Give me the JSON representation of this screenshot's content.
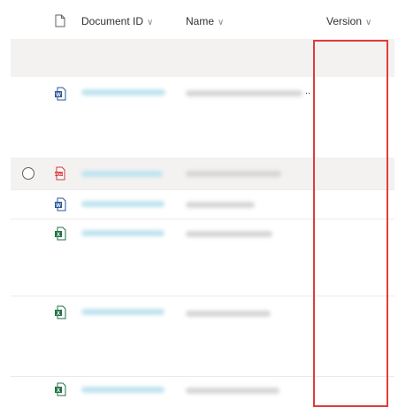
{
  "columns": {
    "document_id": "Document ID",
    "name": "Name",
    "version": "Version"
  },
  "icons": {
    "header_file": "file-icon",
    "sort_chevron": "chevron-down-icon",
    "word": "word-file-icon",
    "pdf": "pdf-file-icon",
    "excel": "excel-file-icon",
    "select": "radio-circle-icon"
  },
  "rows": [
    {
      "type": "word",
      "ellipsis": "..",
      "selected": false
    },
    {
      "type": "pdf",
      "ellipsis": "",
      "selected": false
    },
    {
      "type": "word",
      "ellipsis": "",
      "selected": false
    },
    {
      "type": "excel",
      "ellipsis": "",
      "selected": false
    },
    {
      "type": "excel",
      "ellipsis": "",
      "selected": false
    },
    {
      "type": "excel",
      "ellipsis": "",
      "selected": false
    }
  ],
  "colors": {
    "highlight": "#e03c3c",
    "row_shade": "#f3f2f1",
    "word": "#2b579a",
    "excel": "#217346",
    "pdf": "#d13438"
  }
}
